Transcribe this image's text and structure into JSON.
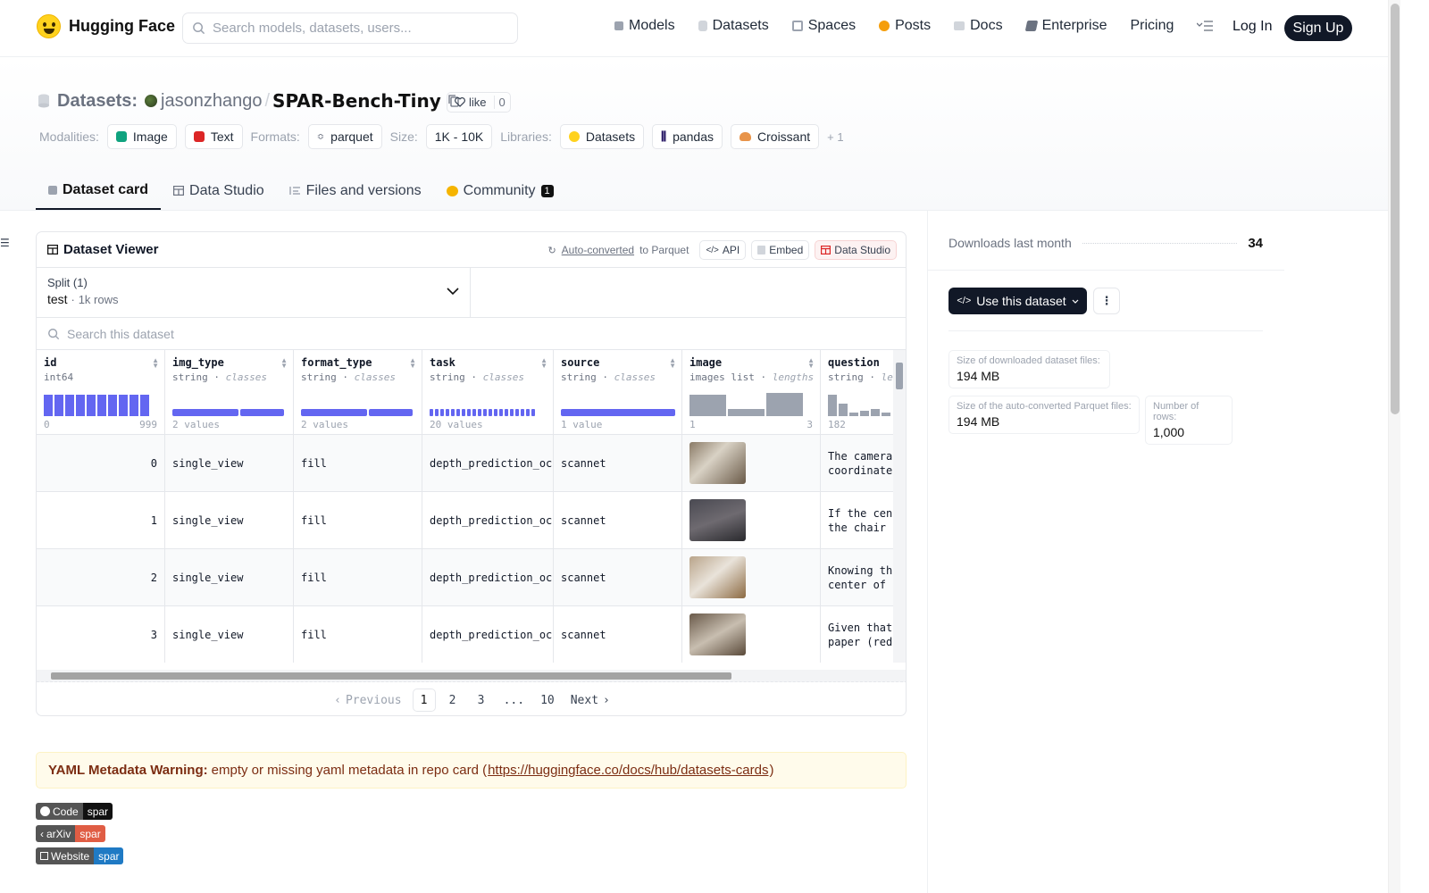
{
  "nav": {
    "brand": "Hugging Face",
    "search_placeholder": "Search models, datasets, users...",
    "links": [
      "Models",
      "Datasets",
      "Spaces",
      "Posts",
      "Docs",
      "Enterprise",
      "Pricing"
    ],
    "login": "Log In",
    "signup": "Sign Up"
  },
  "repo": {
    "type_label": "Datasets:",
    "owner": "jasonzhango",
    "sep": "/",
    "name": "SPAR-Bench-Tiny",
    "like": "like",
    "likes": "0"
  },
  "meta": {
    "modalities_label": "Modalities:",
    "modalities": [
      "Image",
      "Text"
    ],
    "formats_label": "Formats:",
    "format": "parquet",
    "size_label": "Size:",
    "size": "1K - 10K",
    "libraries_label": "Libraries:",
    "libraries": [
      "Datasets",
      "pandas",
      "Croissant"
    ],
    "more": "+ 1"
  },
  "tabs": {
    "card": "Dataset card",
    "studio": "Data Studio",
    "files": "Files and versions",
    "community": "Community",
    "community_count": "1"
  },
  "viewer": {
    "title": "Dataset Viewer",
    "auto_converted": "Auto-converted",
    "to_parquet": "to Parquet",
    "api": "API",
    "embed": "Embed",
    "studio": "Data Studio",
    "split_label": "Split (1)",
    "split_value": "test",
    "split_rows": "1k rows",
    "search_placeholder": "Search this dataset",
    "columns": [
      {
        "name": "id",
        "dtype": "int64",
        "extra": "",
        "foot_left": "0",
        "foot_right": "999"
      },
      {
        "name": "img_type",
        "dtype": "string",
        "extra": "classes",
        "foot_left": "2 values",
        "foot_right": ""
      },
      {
        "name": "format_type",
        "dtype": "string",
        "extra": "classes",
        "foot_left": "2 values",
        "foot_right": ""
      },
      {
        "name": "task",
        "dtype": "string",
        "extra": "classes",
        "foot_left": "20 values",
        "foot_right": ""
      },
      {
        "name": "source",
        "dtype": "string",
        "extra": "classes",
        "foot_left": "1 value",
        "foot_right": ""
      },
      {
        "name": "image",
        "dtype": "images list",
        "extra": "lengths",
        "foot_left": "1",
        "foot_right": "3"
      },
      {
        "name": "question",
        "dtype": "string",
        "extra": "lengths",
        "foot_left": "182",
        "foot_right": ""
      }
    ],
    "rows": [
      {
        "id": "0",
        "img_type": "single_view",
        "format_type": "fill",
        "task": "depth_prediction_oc",
        "source": "scannet",
        "question": "The camera coordinates"
      },
      {
        "id": "1",
        "img_type": "single_view",
        "format_type": "fill",
        "task": "depth_prediction_oc",
        "source": "scannet",
        "question": "If the cent the chair ("
      },
      {
        "id": "2",
        "img_type": "single_view",
        "format_type": "fill",
        "task": "depth_prediction_oc",
        "source": "scannet",
        "question": "Knowing tha center of ("
      },
      {
        "id": "3",
        "img_type": "single_view",
        "format_type": "fill",
        "task": "depth_prediction_oc",
        "source": "scannet",
        "question": "Given that paper (red"
      }
    ],
    "pager": {
      "prev": "Previous",
      "pages": [
        "1",
        "2",
        "3",
        "...",
        "10"
      ],
      "next": "Next"
    }
  },
  "warning": {
    "bold": "YAML Metadata Warning:",
    "text": "empty or missing yaml metadata in repo card (",
    "link": "https://huggingface.co/docs/hub/datasets-cards",
    "close": ")"
  },
  "badges": [
    {
      "left": "Code",
      "right": "spar",
      "color": "#111111"
    },
    {
      "left": "arXiv",
      "right": "spar",
      "color": "#e05d44"
    },
    {
      "left": "Website",
      "right": "spar",
      "color": "#1f7ac4"
    }
  ],
  "side": {
    "downloads_label": "Downloads last month",
    "downloads": "34",
    "use_button": "Use this dataset",
    "size_files_label": "Size of downloaded dataset files:",
    "size_files": "194 MB",
    "size_parquet_label": "Size of the auto-converted Parquet files:",
    "size_parquet": "194 MB",
    "rows_label": "Number of rows:",
    "rows": "1,000"
  },
  "colors": {
    "accent": "#6366f1",
    "dark": "#111827",
    "warning_bg": "#fffbeb"
  }
}
